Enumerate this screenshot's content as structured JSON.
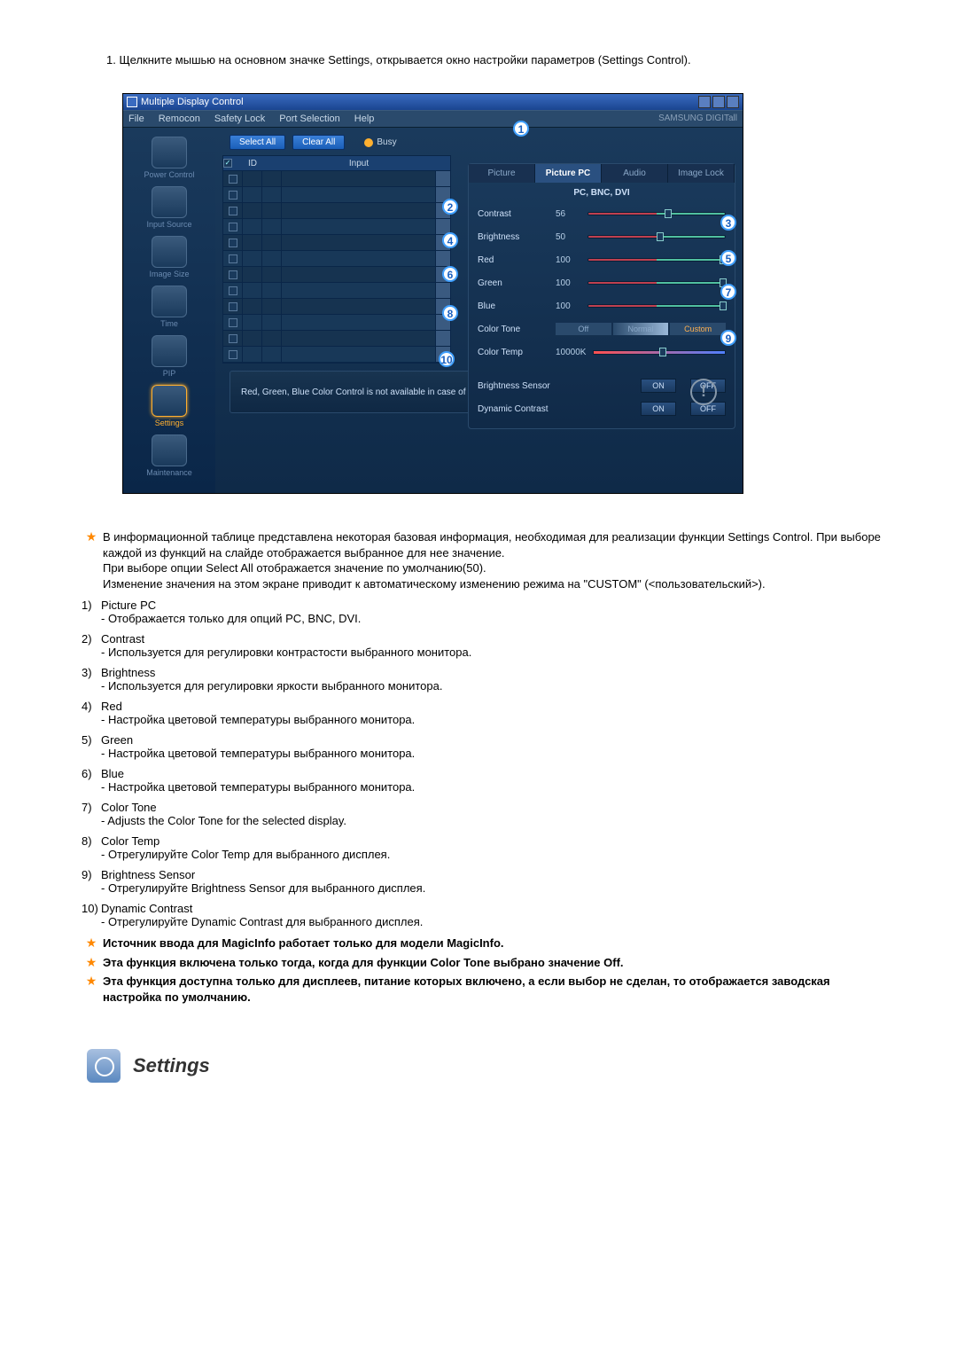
{
  "doc": {
    "instruction": "1.  Щелкните мышью на основном значке Settings, открывается окно настройки параметров (Settings Control).",
    "section_title": "Settings",
    "notes_top": {
      "p1": "В информационной таблице представлена некоторая базовая информация, необходимая для реализации функции Settings Control. При выборе каждой из функций на слайде отображается выбранное для нее значение.",
      "p2": "При выборе опции Select All отображается значение по умолчанию(50).",
      "p3": "Изменение значения на этом экране приводит к автоматическому изменению режима на \"CUSTOM\" (<пользовательский>)."
    },
    "items": [
      {
        "num": "1)",
        "title": "Picture PC",
        "sub": "- Отображается только для опций PC, BNC, DVI."
      },
      {
        "num": "2)",
        "title": "Contrast",
        "sub": "- Используется для регулировки контрастости выбранного монитора."
      },
      {
        "num": "3)",
        "title": "Brightness",
        "sub": "- Используется для регулировки яркости выбранного монитора."
      },
      {
        "num": "4)",
        "title": "Red",
        "sub": "- Настройка цветовой температуры выбранного монитора."
      },
      {
        "num": "5)",
        "title": "Green",
        "sub": "- Настройка цветовой температуры выбранного монитора."
      },
      {
        "num": "6)",
        "title": "Blue",
        "sub": "- Настройка цветовой температуры выбранного монитора."
      },
      {
        "num": "7)",
        "title": "Color Tone",
        "sub": "- Adjusts the Color Tone for the selected display."
      },
      {
        "num": "8)",
        "title": "Color Temp",
        "sub": "- Отрегулируйте Color Temp для выбранного дисплея."
      },
      {
        "num": "9)",
        "title": "Brightness Sensor",
        "sub": "- Отрегулируйте Brightness Sensor для выбранного дисплея."
      },
      {
        "num": "10)",
        "title": "Dynamic Contrast",
        "sub": "- Отрегулируйте Dynamic Contrast для выбранного дисплея."
      }
    ],
    "bold_notes": [
      "Источник ввода для MagicInfo работает только для модели MagicInfo.",
      "Эта функция включена только тогда, когда для функции Color Tone выбрано значение Off.",
      "Эта функция доступна только для дисплеев, питание которых включено, а если выбор не сделан, то отображается заводская настройка по умолчанию."
    ]
  },
  "app": {
    "title": "Multiple Display Control",
    "menu": {
      "file": "File",
      "remocon": "Remocon",
      "safety": "Safety Lock",
      "port": "Port Selection",
      "help": "Help",
      "brand": "SAMSUNG DIGITall"
    },
    "sidebar": [
      {
        "label": "Power Control"
      },
      {
        "label": "Input Source"
      },
      {
        "label": "Image Size"
      },
      {
        "label": "Time"
      },
      {
        "label": "PIP"
      },
      {
        "label": "Settings"
      },
      {
        "label": "Maintenance"
      }
    ],
    "toolbar": {
      "select_all": "Select All",
      "clear_all": "Clear All",
      "busy": "Busy"
    },
    "grid": {
      "col_id": "ID",
      "col_input": "Input"
    },
    "panel": {
      "tabs": {
        "picture": "Picture",
        "picture_pc": "Picture PC",
        "audio": "Audio",
        "image_lock": "Image Lock"
      },
      "head": "PC, BNC, DVI",
      "contrast": "Contrast",
      "contrast_v": "56",
      "brightness": "Brightness",
      "brightness_v": "50",
      "red": "Red",
      "red_v": "100",
      "green": "Green",
      "green_v": "100",
      "blue": "Blue",
      "blue_v": "100",
      "color_tone": "Color Tone",
      "ct_off": "Off",
      "ct_normal": "Normal",
      "ct_custom": "Custom",
      "color_temp": "Color Temp",
      "color_temp_v": "10000K",
      "bsensor": "Brightness Sensor",
      "dcontrast": "Dynamic Contrast",
      "on": "ON",
      "off": "OFF",
      "note": "Red, Green, Blue Color Control is not available in case of DVI Source."
    },
    "callouts": {
      "c1": "1",
      "c2": "2",
      "c3": "3",
      "c4": "4",
      "c5": "5",
      "c6": "6",
      "c7": "7",
      "c8": "8",
      "c9": "9",
      "c10": "10"
    }
  }
}
